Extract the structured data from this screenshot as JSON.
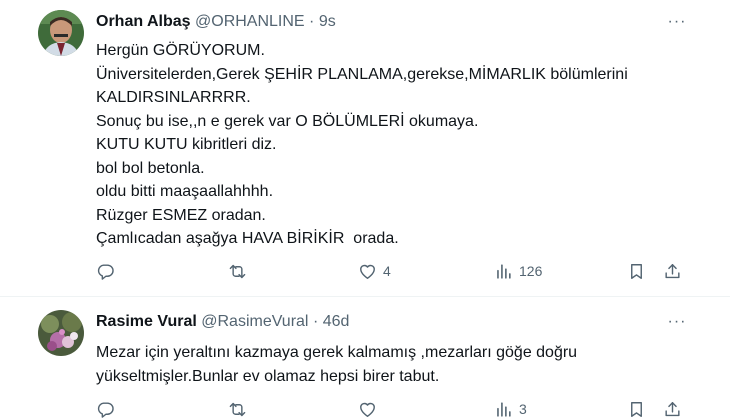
{
  "tweets": [
    {
      "author": {
        "name": "Orhan Albaş",
        "handle": "@ORHANLINE",
        "time": "9s"
      },
      "text": "Hergün GÖRÜYORUM.\nÜniversitelerden,Gerek ŞEHİR PLANLAMA,gerekse,MİMARLIK bölümlerini\nKALDIRSINLARRRR.\nSonuç bu ise,,n e gerek var O BÖLÜMLERİ okumaya.\nKUTU KUTU kibritleri diz.\nbol bol betonla.\noldu bitti maaşaallahhhh.\nRüzger ESMEZ oradan.\nÇamlıcadan aşağya HAVA BİRİKİR  orada.",
      "stats": {
        "replies": "",
        "retweets": "",
        "likes": "4",
        "views": "126"
      }
    },
    {
      "author": {
        "name": "Rasime Vural",
        "handle": "@RasimeVural",
        "time": "46d"
      },
      "text": "Mezar için yeraltını kazmaya gerek kalmamış ,mezarları göğe doğru\nyükseltmişler.Bunlar ev olamaz hepsi birer tabut.",
      "stats": {
        "replies": "",
        "retweets": "",
        "likes": "",
        "views": "3"
      }
    }
  ],
  "separator": "·",
  "more_glyph": "···",
  "icons": {
    "reply": "reply-icon",
    "retweet": "retweet-icon",
    "like": "heart-icon",
    "views": "views-icon",
    "bookmark": "bookmark-icon",
    "share": "share-icon"
  },
  "colors": {
    "text": "#0f1419",
    "secondary": "#536471",
    "divider": "#eff3f4"
  }
}
